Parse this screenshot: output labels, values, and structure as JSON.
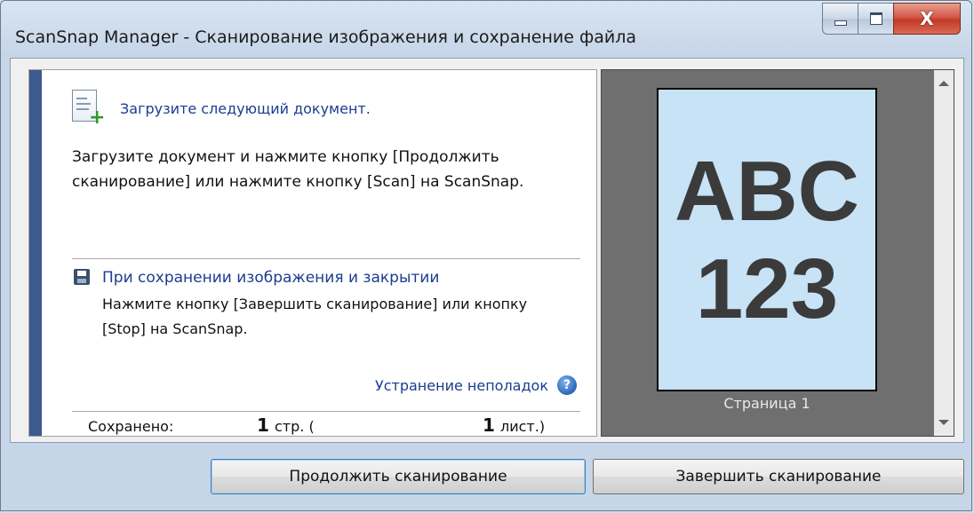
{
  "window": {
    "title": "ScanSnap Manager - Сканирование изображения и сохранение файла",
    "controls": {
      "minimize": "—",
      "maximize": "□",
      "close": "X"
    }
  },
  "instructions": {
    "next_title": "Загрузите следующий документ.",
    "next_desc": "Загрузите документ и нажмите кнопку [Продолжить сканирование] или нажмите кнопку [Scan] на ScanSnap.",
    "save_title": "При сохранении изображения и закрытии",
    "save_desc": "Нажмите кнопку [Завершить сканирование] или кнопку [Stop] на ScanSnap.",
    "troubleshoot_link": "Устранение неполадок",
    "help_glyph": "?"
  },
  "status": {
    "saved_label": "Сохранено:",
    "pages_count": "1",
    "pages_unit": "стр. (",
    "sheets_count": "1",
    "sheets_unit": "лист.)"
  },
  "preview": {
    "line1": "ABC",
    "line2": "123",
    "page_label": "Страница 1"
  },
  "buttons": {
    "continue": "Продолжить сканирование",
    "finish": "Завершить сканирование"
  },
  "colors": {
    "accent": "#3d5a8e",
    "link": "#1a3d8f",
    "preview_bg": "#6f6f6f",
    "page_bg": "#c8e2f6"
  }
}
